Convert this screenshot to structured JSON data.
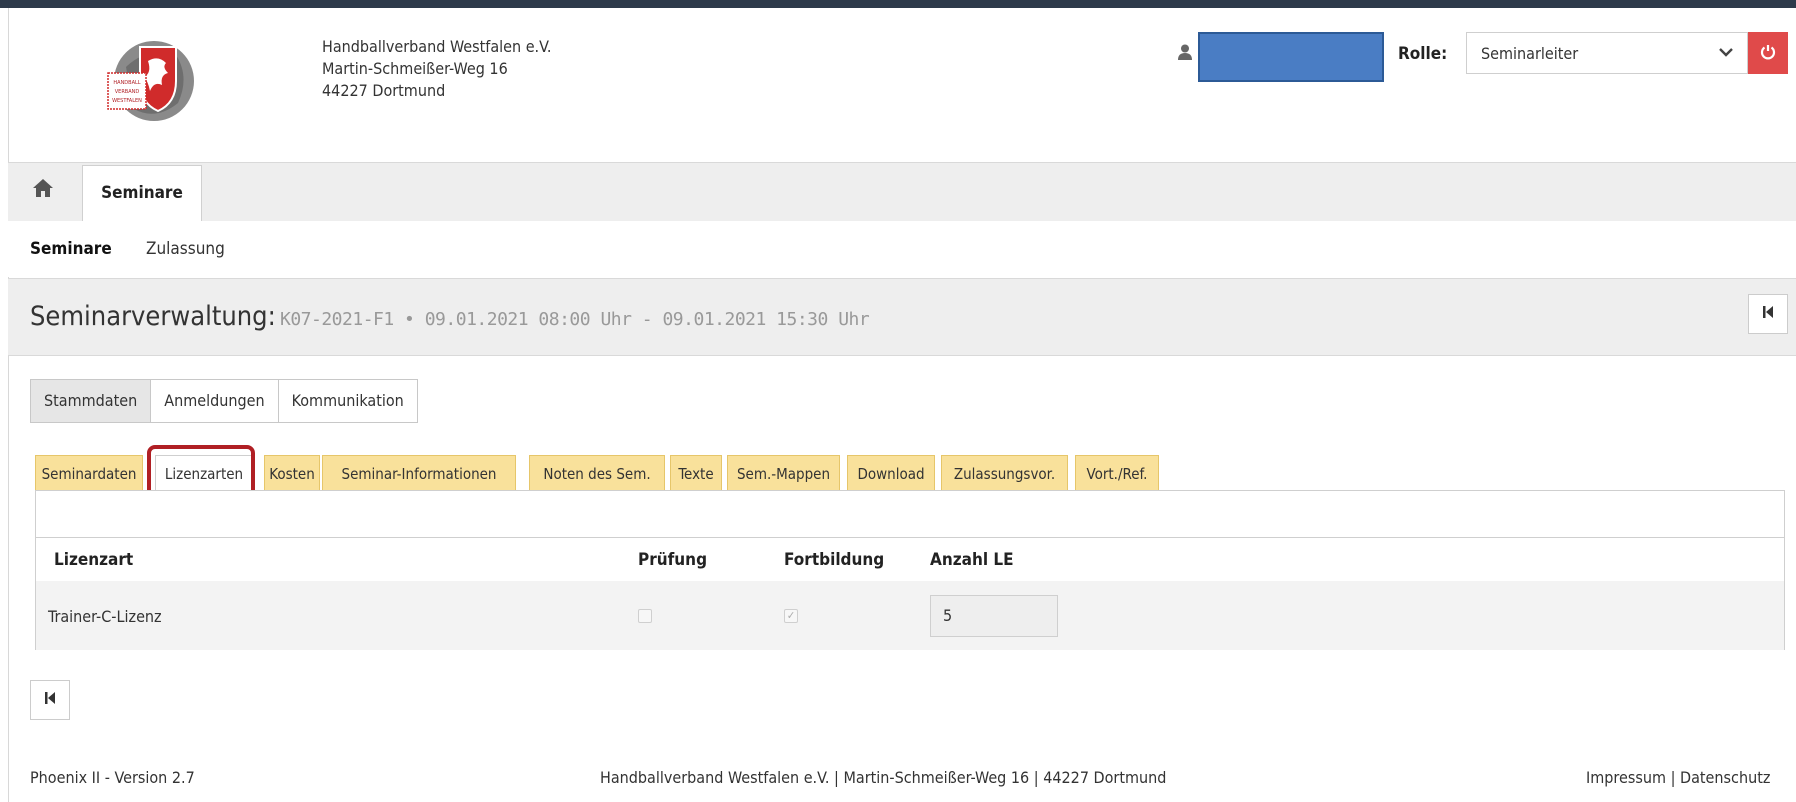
{
  "header": {
    "org_lines": [
      "Handballverband Westfalen e.V.",
      "Martin-Schmeißer-Weg 16",
      "44227 Dortmund"
    ],
    "logo_text": [
      "HANDBALL",
      "VERBAND",
      "WESTFALEN"
    ],
    "user_icon": "user-icon",
    "user_name_redacted": true,
    "rolle_label": "Rolle:",
    "role_value": "Seminarleiter",
    "logout_icon": "power-icon"
  },
  "main_nav": {
    "home_icon": "home-icon",
    "tab_label": "Seminare"
  },
  "sub_nav": {
    "items": [
      "Seminare",
      "Zulassung"
    ]
  },
  "title_bar": {
    "title": "Seminarverwaltung:",
    "subtitle": "K07-2021-F1 • 09.01.2021 08:00 Uhr - 09.01.2021 15:30 Uhr",
    "back_icon": "first-page-icon"
  },
  "button_group": [
    "Stammdaten",
    "Anmeldungen",
    "Kommunikation"
  ],
  "active_button": "Stammdaten",
  "tabs": [
    "Seminardaten",
    "Lizenzarten",
    "Kosten",
    "Seminar-Informationen",
    "Noten des Sem.",
    "Texte",
    "Sem.-Mappen",
    "Download",
    "Zulassungsvor.",
    "Vort./Ref."
  ],
  "active_tab": "Lizenzarten",
  "highlight_color": "#b01f24",
  "table": {
    "headers": [
      "Lizenzart",
      "Prüfung",
      "Fortbildung",
      "Anzahl LE"
    ],
    "rows": [
      {
        "lizenzart": "Trainer-C-Lizenz",
        "pruefung": false,
        "fortbildung": true,
        "anzahl_le": "5"
      }
    ]
  },
  "footer": {
    "version": "Phoenix II - Version 2.7",
    "address": "Handballverband Westfalen e.V. | Martin-Schmeißer-Weg 16 | 44227 Dortmund",
    "impressum": "Impressum",
    "separator": "|",
    "datenschutz": "Datenschutz"
  },
  "colors": {
    "tab_yellow": "#f9e19b",
    "logout_red": "#e04a4a",
    "redaction_blue": "#4a7dc4"
  }
}
